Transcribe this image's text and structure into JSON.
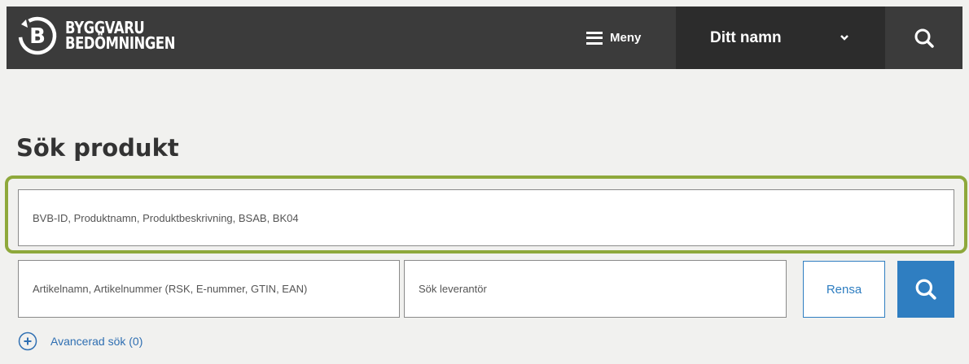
{
  "header": {
    "logo_line1": "BYGGVARU",
    "logo_line2": "BEDÖMNINGEN",
    "logo_letter": "B",
    "menu_label": "Meny",
    "user_name": "Ditt namn"
  },
  "main": {
    "title": "Sök produkt",
    "search_placeholder": "BVB-ID, Produktnamn, Produktbeskrivning, BSAB, BK04",
    "article_placeholder": "Artikelnamn, Artikelnummer (RSK, E-nummer, GTIN, EAN)",
    "supplier_placeholder": "Sök leverantör",
    "clear_label": "Rensa",
    "advanced_label": "Avancerad sök (0)"
  },
  "colors": {
    "header_bg": "#3b3b3b",
    "accent_blue": "#2f7ec1",
    "highlight_green": "#8ea83b"
  },
  "icons": [
    "logo-icon",
    "hamburger-icon",
    "chevron-down-icon",
    "search-icon",
    "plus-circle-icon"
  ]
}
